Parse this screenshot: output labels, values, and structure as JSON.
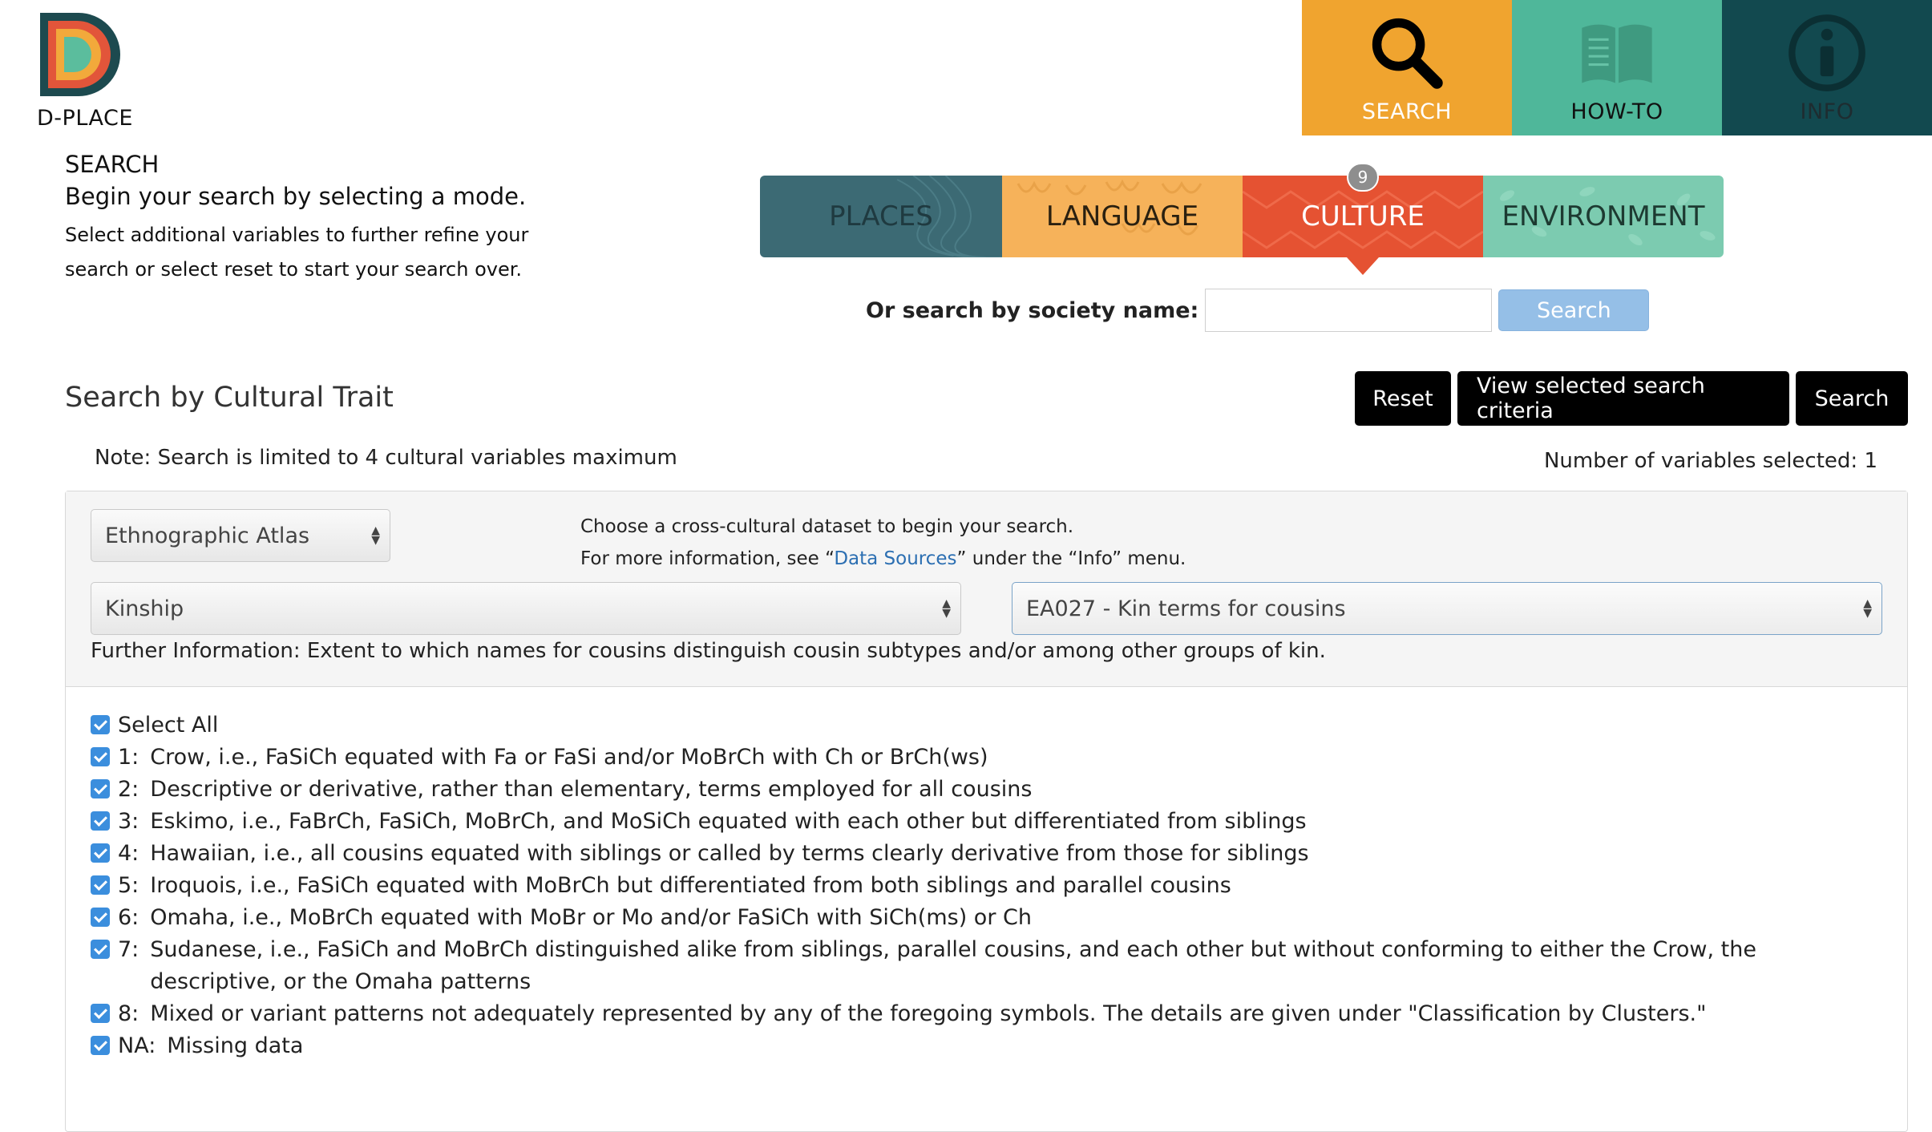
{
  "logo": {
    "text": "D-PLACE"
  },
  "nav": [
    {
      "label": "SEARCH",
      "icon": "search-icon",
      "color": "#f0a42f"
    },
    {
      "label": "HOW-TO",
      "icon": "book-icon",
      "color": "#4fb79a"
    },
    {
      "label": "INFO",
      "icon": "info-icon",
      "color": "#12494f"
    }
  ],
  "intro": {
    "heading": "SEARCH",
    "line1": "Begin your search by selecting a mode.",
    "line2": "Select additional variables to further refine your search or select reset to start your search over."
  },
  "modes": [
    {
      "label": "PLACES"
    },
    {
      "label": "LANGUAGE"
    },
    {
      "label": "CULTURE",
      "badge": "9",
      "active": true
    },
    {
      "label": "ENVIRONMENT"
    }
  ],
  "society_search": {
    "label": "Or search by society name:",
    "value": "",
    "button": "Search"
  },
  "section": {
    "title": "Search by Cultural Trait",
    "note": "Note: Search is limited to 4 cultural variables maximum",
    "num_selected_label": "Number of variables selected:",
    "num_selected_value": "1",
    "buttons": {
      "reset": "Reset",
      "view": "View selected search criteria",
      "search": "Search"
    }
  },
  "filters": {
    "dataset": "Ethnographic Atlas",
    "dataset_help_1": "Choose a cross-cultural dataset to begin your search.",
    "dataset_help_2_pre": "For more information, see “",
    "dataset_help_link": "Data Sources",
    "dataset_help_2_post": "” under the “Info” menu.",
    "category": "Kinship",
    "variable": "EA027 - Kin terms for cousins",
    "further_info": "Further Information: Extent to which names for cousins distinguish cousin subtypes and/or among other groups of kin."
  },
  "codes": {
    "select_all": "Select All",
    "items": [
      {
        "code": "1:",
        "text": "Crow, i.e., FaSiCh equated with Fa or FaSi and/or MoBrCh with Ch or BrCh(ws)"
      },
      {
        "code": "2:",
        "text": "Descriptive or derivative, rather than elementary, terms employed for all cousins"
      },
      {
        "code": "3:",
        "text": "Eskimo, i.e., FaBrCh, FaSiCh, MoBrCh, and MoSiCh equated with each other but differentiated from siblings"
      },
      {
        "code": "4:",
        "text": "Hawaiian, i.e., all cousins equated with siblings or called by terms clearly derivative from those for siblings"
      },
      {
        "code": "5:",
        "text": "Iroquois, i.e., FaSiCh equated with MoBrCh but differentiated from both siblings and parallel cousins"
      },
      {
        "code": "6:",
        "text": "Omaha, i.e., MoBrCh equated with MoBr or Mo and/or FaSiCh with SiCh(ms) or Ch"
      },
      {
        "code": "7:",
        "text": "Sudanese, i.e., FaSiCh and MoBrCh distinguished alike from siblings, parallel cousins, and each other but without conforming to either the Crow, the descriptive, or the Omaha patterns"
      },
      {
        "code": "8:",
        "text": "Mixed or variant patterns not adequately represented by any of the foregoing symbols. The details are given under \"Classification by Clusters.\""
      },
      {
        "code": "NA:",
        "text": "Missing data"
      }
    ]
  }
}
